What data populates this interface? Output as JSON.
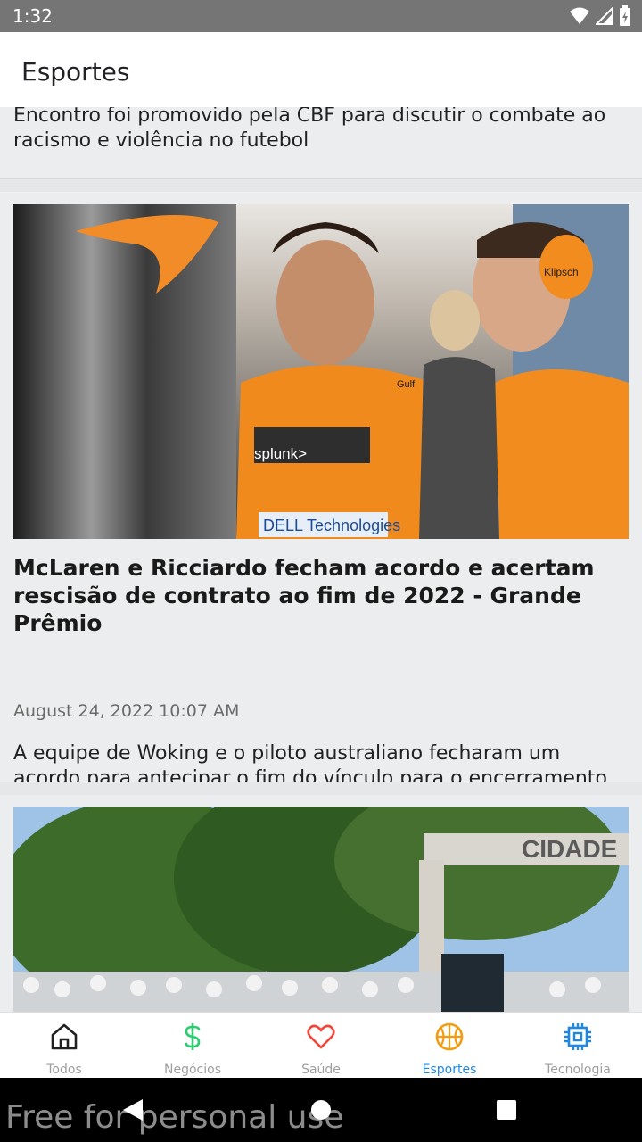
{
  "status_bar": {
    "time": "1:32"
  },
  "app_bar": {
    "title": "Esportes"
  },
  "articles": [
    {
      "description": "Encontro foi promovido pela CBF para discutir o combate ao racismo e violência no futebol"
    },
    {
      "image_alt": "Driver in orange racing suit talking with team engineer wearing headset",
      "image_text": [
        "Klipsch",
        "splunk>",
        "DELL Technologies",
        "Gulf"
      ],
      "headline": "McLaren e Ricciardo fecham acordo e acertam rescisão de contrato ao fim de 2022 - Grande Prêmio",
      "date": "August 24, 2022 10:07 AM",
      "description": "A equipe de Woking e o piloto australiano fecharam um acordo para antecipar o fim do vínculo para o encerramento da temporada 2022. McLaren tem caminho livre para assinar com Piastri"
    },
    {
      "image_alt": "Crowd of fans in white shirts in front of a gate with trees",
      "image_text": [
        "CIDADE"
      ]
    }
  ],
  "bottom_nav": {
    "items": [
      {
        "label": "Todos",
        "icon": "home-icon",
        "color": "#212121"
      },
      {
        "label": "Negócios",
        "icon": "dollar-icon",
        "color": "#2ecc71"
      },
      {
        "label": "Saúde",
        "icon": "heart-icon",
        "color": "#f44336"
      },
      {
        "label": "Esportes",
        "icon": "basketball-icon",
        "color": "#f39c12"
      },
      {
        "label": "Tecnologia",
        "icon": "chip-icon",
        "color": "#1e88e5"
      }
    ],
    "active": "Esportes",
    "active_color": "#1e88e5"
  },
  "watermark": "Free for personal use"
}
